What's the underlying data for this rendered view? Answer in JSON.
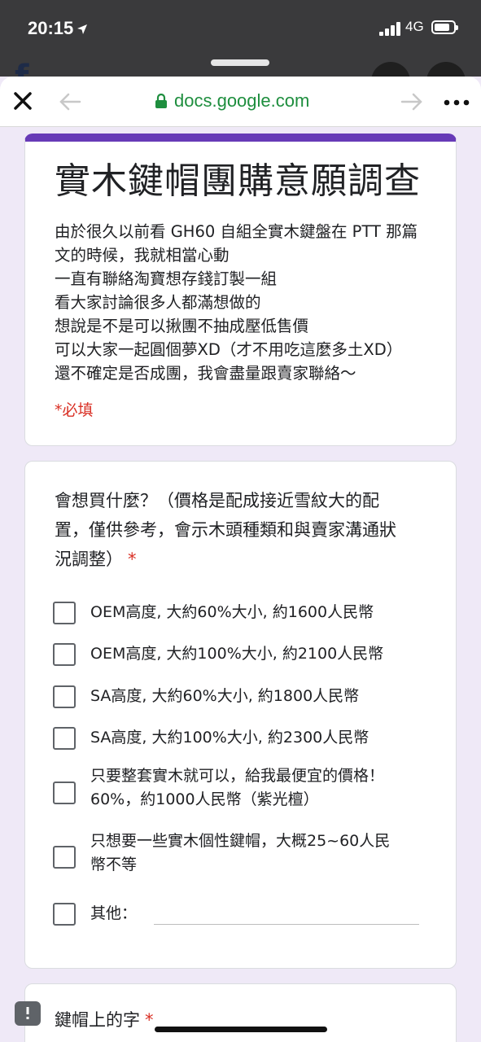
{
  "status_bar": {
    "time": "20:15",
    "network": "4G"
  },
  "browser": {
    "url": "docs.google.com"
  },
  "form": {
    "title": "實木鍵帽團購意願調查",
    "description": [
      "由於很久以前看 GH60 自組全實木鍵盤在 PTT 那篇",
      "文的時候，我就相當心動",
      "一直有聯絡淘寶想存錢訂製一組",
      "看大家討論很多人都滿想做的",
      "想說是不是可以揪團不抽成壓低售價",
      "可以大家一起圓個夢XD（才不用吃這麼多土XD）",
      "還不確定是否成團，我會盡量跟賣家聯絡～"
    ],
    "required_note": "*必填"
  },
  "question1": {
    "title_lines": [
      "會想買什麼？（價格是配成接近雪紋大的配",
      "置，僅供參考，會示木頭種類和與賣家溝通狀",
      "況調整）"
    ],
    "required_mark": "*",
    "options": [
      {
        "lines": [
          "OEM高度, 大約60%大小, 約1600人民幣"
        ]
      },
      {
        "lines": [
          "OEM高度, 大約100%大小, 約2100人民幣"
        ]
      },
      {
        "lines": [
          "SA高度, 大約60%大小, 約1800人民幣"
        ]
      },
      {
        "lines": [
          "SA高度, 大約100%大小, 約2300人民幣"
        ]
      },
      {
        "lines": [
          "只要整套實木就可以，給我最便宜的價格！",
          "60%，約1000人民幣（紫光檀）"
        ]
      },
      {
        "lines": [
          "只想要一些實木個性鍵帽，大概25~60人民",
          "幣不等"
        ]
      }
    ],
    "other_label": "其他："
  },
  "question2": {
    "title": "鍵帽上的字",
    "required_mark": "*"
  },
  "colors": {
    "accent": "#673ab7",
    "required": "#d93025",
    "url_green": "#1e8e3e",
    "background": "#efe9f7"
  }
}
